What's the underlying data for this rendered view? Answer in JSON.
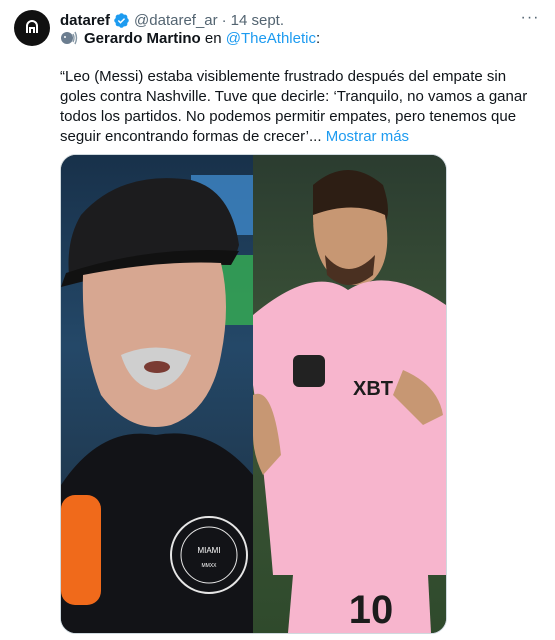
{
  "tweet": {
    "author_name": "dataref",
    "author_handle": "@dataref_ar",
    "separator": "·",
    "date": "14 sept.",
    "more_label": "···",
    "quote_speaker": "Gerardo Martino",
    "quote_connector": "en",
    "quote_source": "@TheAthletic",
    "quote_colon": ":",
    "body": "“Leo (Messi) estaba visiblemente frustrado después del empate sin goles contra Nashville. Tuve que decirle: ‘Tranquilo, no vamos a ganar todos los partidos. No podemos permitir empates, pero tenemos que seguir encontrando formas de crecer’...",
    "show_more": "Mostrar más"
  },
  "media": {
    "left_logo_text": "MIAMI",
    "left_logo_ring": "CLUB INTERNACIONAL DE FUTBOL",
    "left_logo_year": "MMXX",
    "right_sponsor": "XBT",
    "right_jersey_number": "10"
  },
  "colors": {
    "link": "#1d9bf0",
    "verified": "#1d9bf0",
    "secondary_text": "#536471",
    "inter_pink": "#f7b5cd"
  },
  "icons": {
    "verified": "verified-badge-icon",
    "speaker": "speaking-head-icon",
    "more": "more-options-icon"
  }
}
